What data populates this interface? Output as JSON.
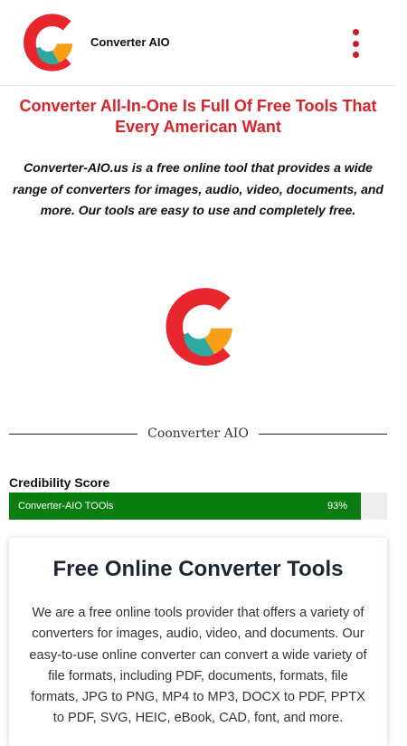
{
  "header": {
    "brand": "Converter AIO",
    "menu_icon": "kebab-menu-icon",
    "logo_icon": "converter-aio-logo-icon"
  },
  "hero": {
    "headline": "Converter All-In-One Is Full Of Free Tools That Every American Want",
    "intro": "Converter-AIO.us is a free online tool that provides a wide range of converters for images, audio, video, documents, and more. Our tools are easy to use and completely free."
  },
  "divider": {
    "label": "Coonverter AIO"
  },
  "credibility": {
    "title": "Credibility Score",
    "bar_label": "Converter-AIO TOOls",
    "percent_text": "93%",
    "percent_value": 93
  },
  "tools_card": {
    "title": "Free Online Converter Tools",
    "body": "We are a free online tools provider that offers a variety of converters for images, audio, video, and documents. Our easy-to-use online converter can convert a wide variety of file formats, including PDF, documents, formats, file formats, JPG to PNG, MP4 to MP3, DOCX to PDF, PPTX to PDF, SVG, HEIC, eBook, CAD, font, and more."
  },
  "colors": {
    "accent_red": "#d7242b",
    "progress_green": "#0a7d10",
    "logo_red": "#e8262e",
    "logo_orange": "#f6a01a",
    "logo_teal": "#2fa8a0"
  }
}
